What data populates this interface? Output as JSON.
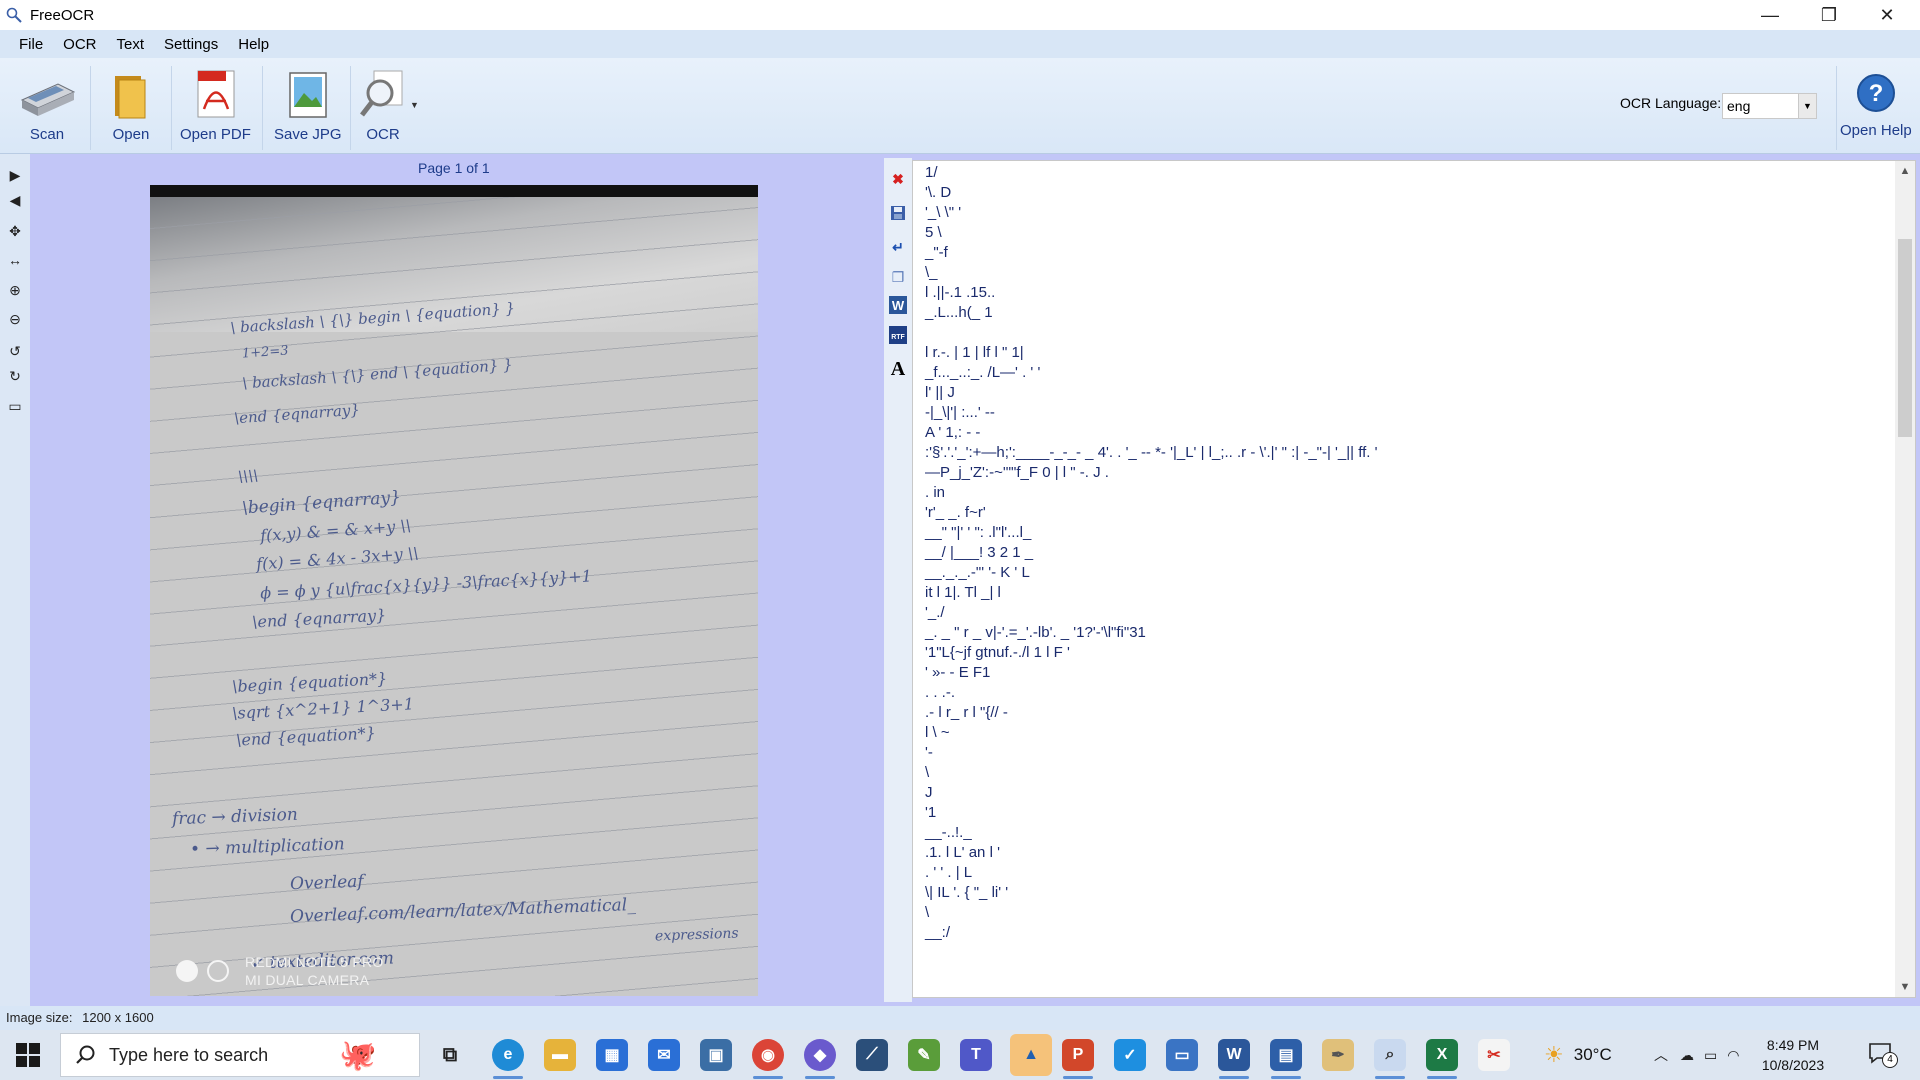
{
  "window": {
    "title": "FreeOCR",
    "controls": {
      "minimize": "—",
      "restore": "❐",
      "close": "✕"
    }
  },
  "menu": [
    "File",
    "OCR",
    "Text",
    "Settings",
    "Help"
  ],
  "toolbar": {
    "scan": "Scan",
    "open": "Open",
    "open_pdf": "Open PDF",
    "save_jpg": "Save JPG",
    "ocr": "OCR",
    "ocr_language_label": "OCR Language:",
    "ocr_language_value": "eng",
    "open_help": "Open Help"
  },
  "viewer": {
    "page_label": "Page 1 of 1",
    "image_watermark_line1": "REDMI NOTE 5 PRO",
    "image_watermark_line2": "MI DUAL CAMERA"
  },
  "ocr_text_lines": [
    "1/",
    "'\\. D",
    "'_\\ \\\" '",
    "5 \\",
    "_\"-f",
    "\\_",
    "l .||-.1 .15..",
    "_.L...h(_ 1",
    "",
    "l r.-. | 1 | lf l \" 1|",
    "_f..._..:_. /L—' . ' '",
    "l' || J",
    "-|_\\|'| :...' --",
    "A ' 1,: - -",
    ":'§'.'.'_':+—h;':____-_-_- _ 4'. . '_ -- *- '|_L' | l_;.. .r - \\'.|' \" :| -_\"-| '_|| ff. '",
    "—P_j_'Z':-~'\"\"f_F 0 | l \" -. J .",
    ". in",
    "'r'_ _. f~r'",
    "__\" \"|' ' \": .l\"l'...l_",
    "__/ |___! 3 2 1 _",
    "__._._.-\"' '- K ' L",
    "it l 1|. Tl _| l",
    "'_./",
    "_. _ \" r _ v|-'.=_'.-lb'. _ '1?'-'\\l\"fi\"31",
    "'1\"L{~jf gtnuf.-./l 1 l F '",
    "' »- - E F1",
    ". . .-.",
    ".- l r_ r l \"{// -",
    "l \\ ~",
    "'-",
    "\\",
    "J",
    "'1",
    "__-..!._",
    ".1. l L' an l '",
    ". ' ' . | L",
    "\\| IL '. { \"_ li' '",
    "\\",
    "__:/"
  ],
  "statusbar": {
    "image_size_label": "Image size:",
    "image_size_value": "1200 x 1600"
  },
  "taskbar": {
    "search_placeholder": "Type here to search",
    "weather": "30°C",
    "time": "8:49 PM",
    "date": "10/8/2023",
    "notification_count": "4"
  },
  "colors": {
    "viewer_background": "#c2c6f7",
    "menu_background": "#d8e6f6",
    "ocr_text": "#1a2a6c",
    "label_text": "#1e3c8a"
  }
}
